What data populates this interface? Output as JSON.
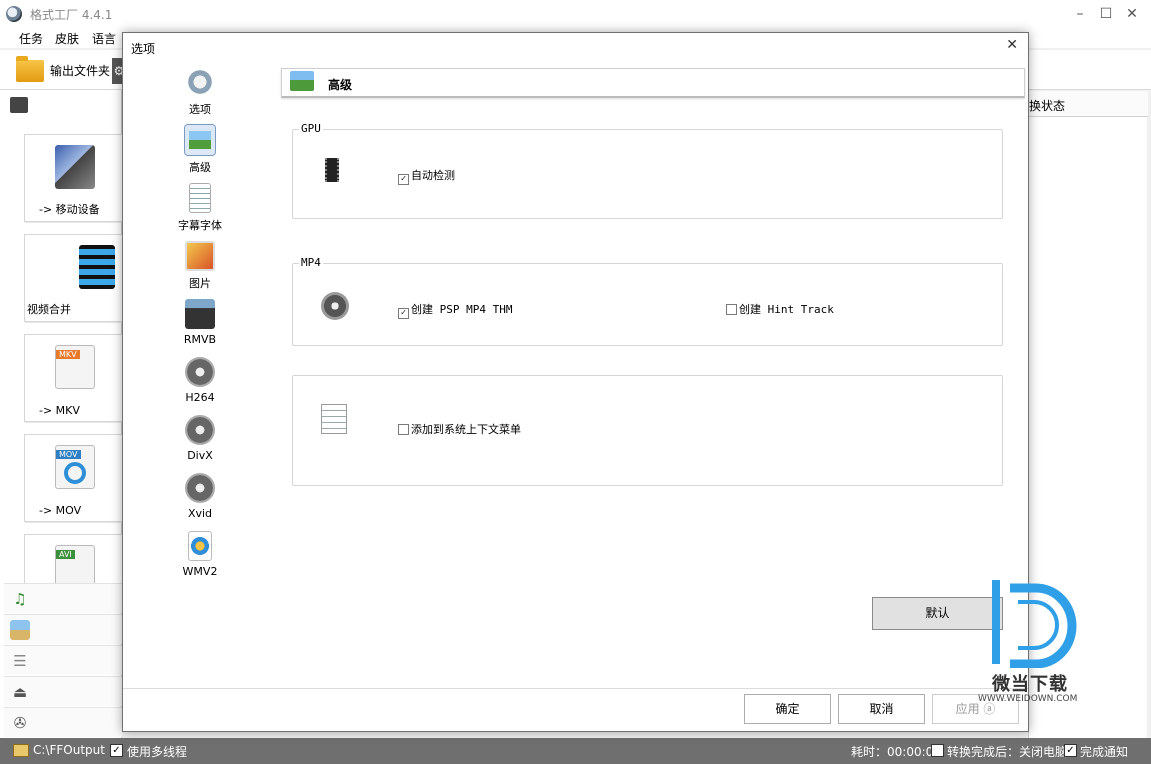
{
  "main_window": {
    "title": "格式工厂 4.4.1",
    "menu": [
      "任务",
      "皮肤",
      "语言"
    ],
    "toolbar": {
      "output_folder_label": "输出文件夹"
    },
    "left_cards": [
      {
        "label": "-> 移动设备",
        "icon": "mobile-device-icon"
      },
      {
        "label": "视频合并",
        "icon": "film-strip-icon"
      },
      {
        "label": "-> MKV",
        "icon": "mkv-file-icon",
        "badge": "MKV"
      },
      {
        "label": "-> MOV",
        "icon": "mov-file-icon",
        "badge": "MOV"
      },
      {
        "label": "",
        "icon": "avi-file-icon",
        "badge": "AVI"
      }
    ],
    "right_panel": {
      "column_header": "换状态"
    },
    "statusbar": {
      "output_path": "C:\\FFOutput",
      "multithread_label": "使用多线程",
      "elapsed": "耗时：00:00:00",
      "shutdown_label": "转换完成后：关闭电脑",
      "notify_label": "完成通知"
    }
  },
  "dialog": {
    "title": "选项",
    "nav": [
      {
        "label": "选项",
        "icon": "options-icon"
      },
      {
        "label": "高级",
        "icon": "advanced-icon",
        "selected": true
      },
      {
        "label": "字幕字体",
        "icon": "subtitle-font-icon"
      },
      {
        "label": "图片",
        "icon": "picture-icon"
      },
      {
        "label": "RMVB",
        "icon": "rmvb-icon"
      },
      {
        "label": "H264",
        "icon": "h264-icon"
      },
      {
        "label": "DivX",
        "icon": "divx-icon"
      },
      {
        "label": "Xvid",
        "icon": "xvid-icon"
      },
      {
        "label": "WMV2",
        "icon": "wmv2-icon"
      }
    ],
    "section_title": "高级",
    "groups": {
      "gpu": {
        "title": "GPU",
        "auto_detect": {
          "label": "自动检测",
          "checked": true
        }
      },
      "mp4": {
        "title": "MP4",
        "create_psp_thm": {
          "label": "创建 PSP MP4 THM",
          "checked": true
        },
        "create_hint_track": {
          "label": "创建 Hint Track",
          "checked": false
        }
      },
      "context": {
        "title": "",
        "add_context_menu": {
          "label": "添加到系统上下文菜单",
          "checked": false
        }
      }
    },
    "buttons": {
      "default": "默认",
      "ok": "确定",
      "cancel": "取消",
      "apply": "应用 ⓐ"
    }
  },
  "watermark": {
    "text": "微当下载",
    "url": "WWW.WEIDOWN.COM"
  },
  "colors": {
    "statusbar_bg": "#6f6f6f",
    "watermark_blue": "#2f9fe8"
  }
}
